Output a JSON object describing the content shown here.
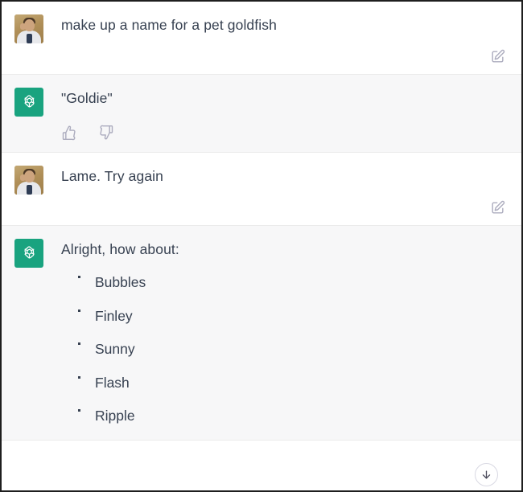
{
  "colors": {
    "assistant_avatar_bg": "#19a37f",
    "assistant_row_bg": "#f7f7f8",
    "user_row_bg": "#ffffff",
    "text": "#374151",
    "icon": "#acacbe",
    "window_border": "#1e1e1e"
  },
  "messages": [
    {
      "role": "user",
      "avatar_icon": "user-photo-avatar",
      "text": "make up a name for a pet goldfish",
      "actions": [
        {
          "name": "edit-message-button",
          "icon": "edit-pencil-square-icon"
        }
      ]
    },
    {
      "role": "assistant",
      "avatar_icon": "chatgpt-logo-icon",
      "text": "\"Goldie\"",
      "actions": [
        {
          "name": "thumbs-up-button",
          "icon": "thumbs-up-icon"
        },
        {
          "name": "thumbs-down-button",
          "icon": "thumbs-down-icon"
        }
      ]
    },
    {
      "role": "user",
      "avatar_icon": "user-photo-avatar",
      "text": "Lame. Try again",
      "actions": [
        {
          "name": "edit-message-button",
          "icon": "edit-pencil-square-icon"
        }
      ]
    },
    {
      "role": "assistant",
      "avatar_icon": "chatgpt-logo-icon",
      "text": "Alright, how about:",
      "list": [
        "Bubbles",
        "Finley",
        "Sunny",
        "Flash",
        "Ripple"
      ],
      "actions": []
    }
  ],
  "scroll_button": {
    "name": "scroll-to-bottom-button",
    "icon": "arrow-down-icon"
  }
}
